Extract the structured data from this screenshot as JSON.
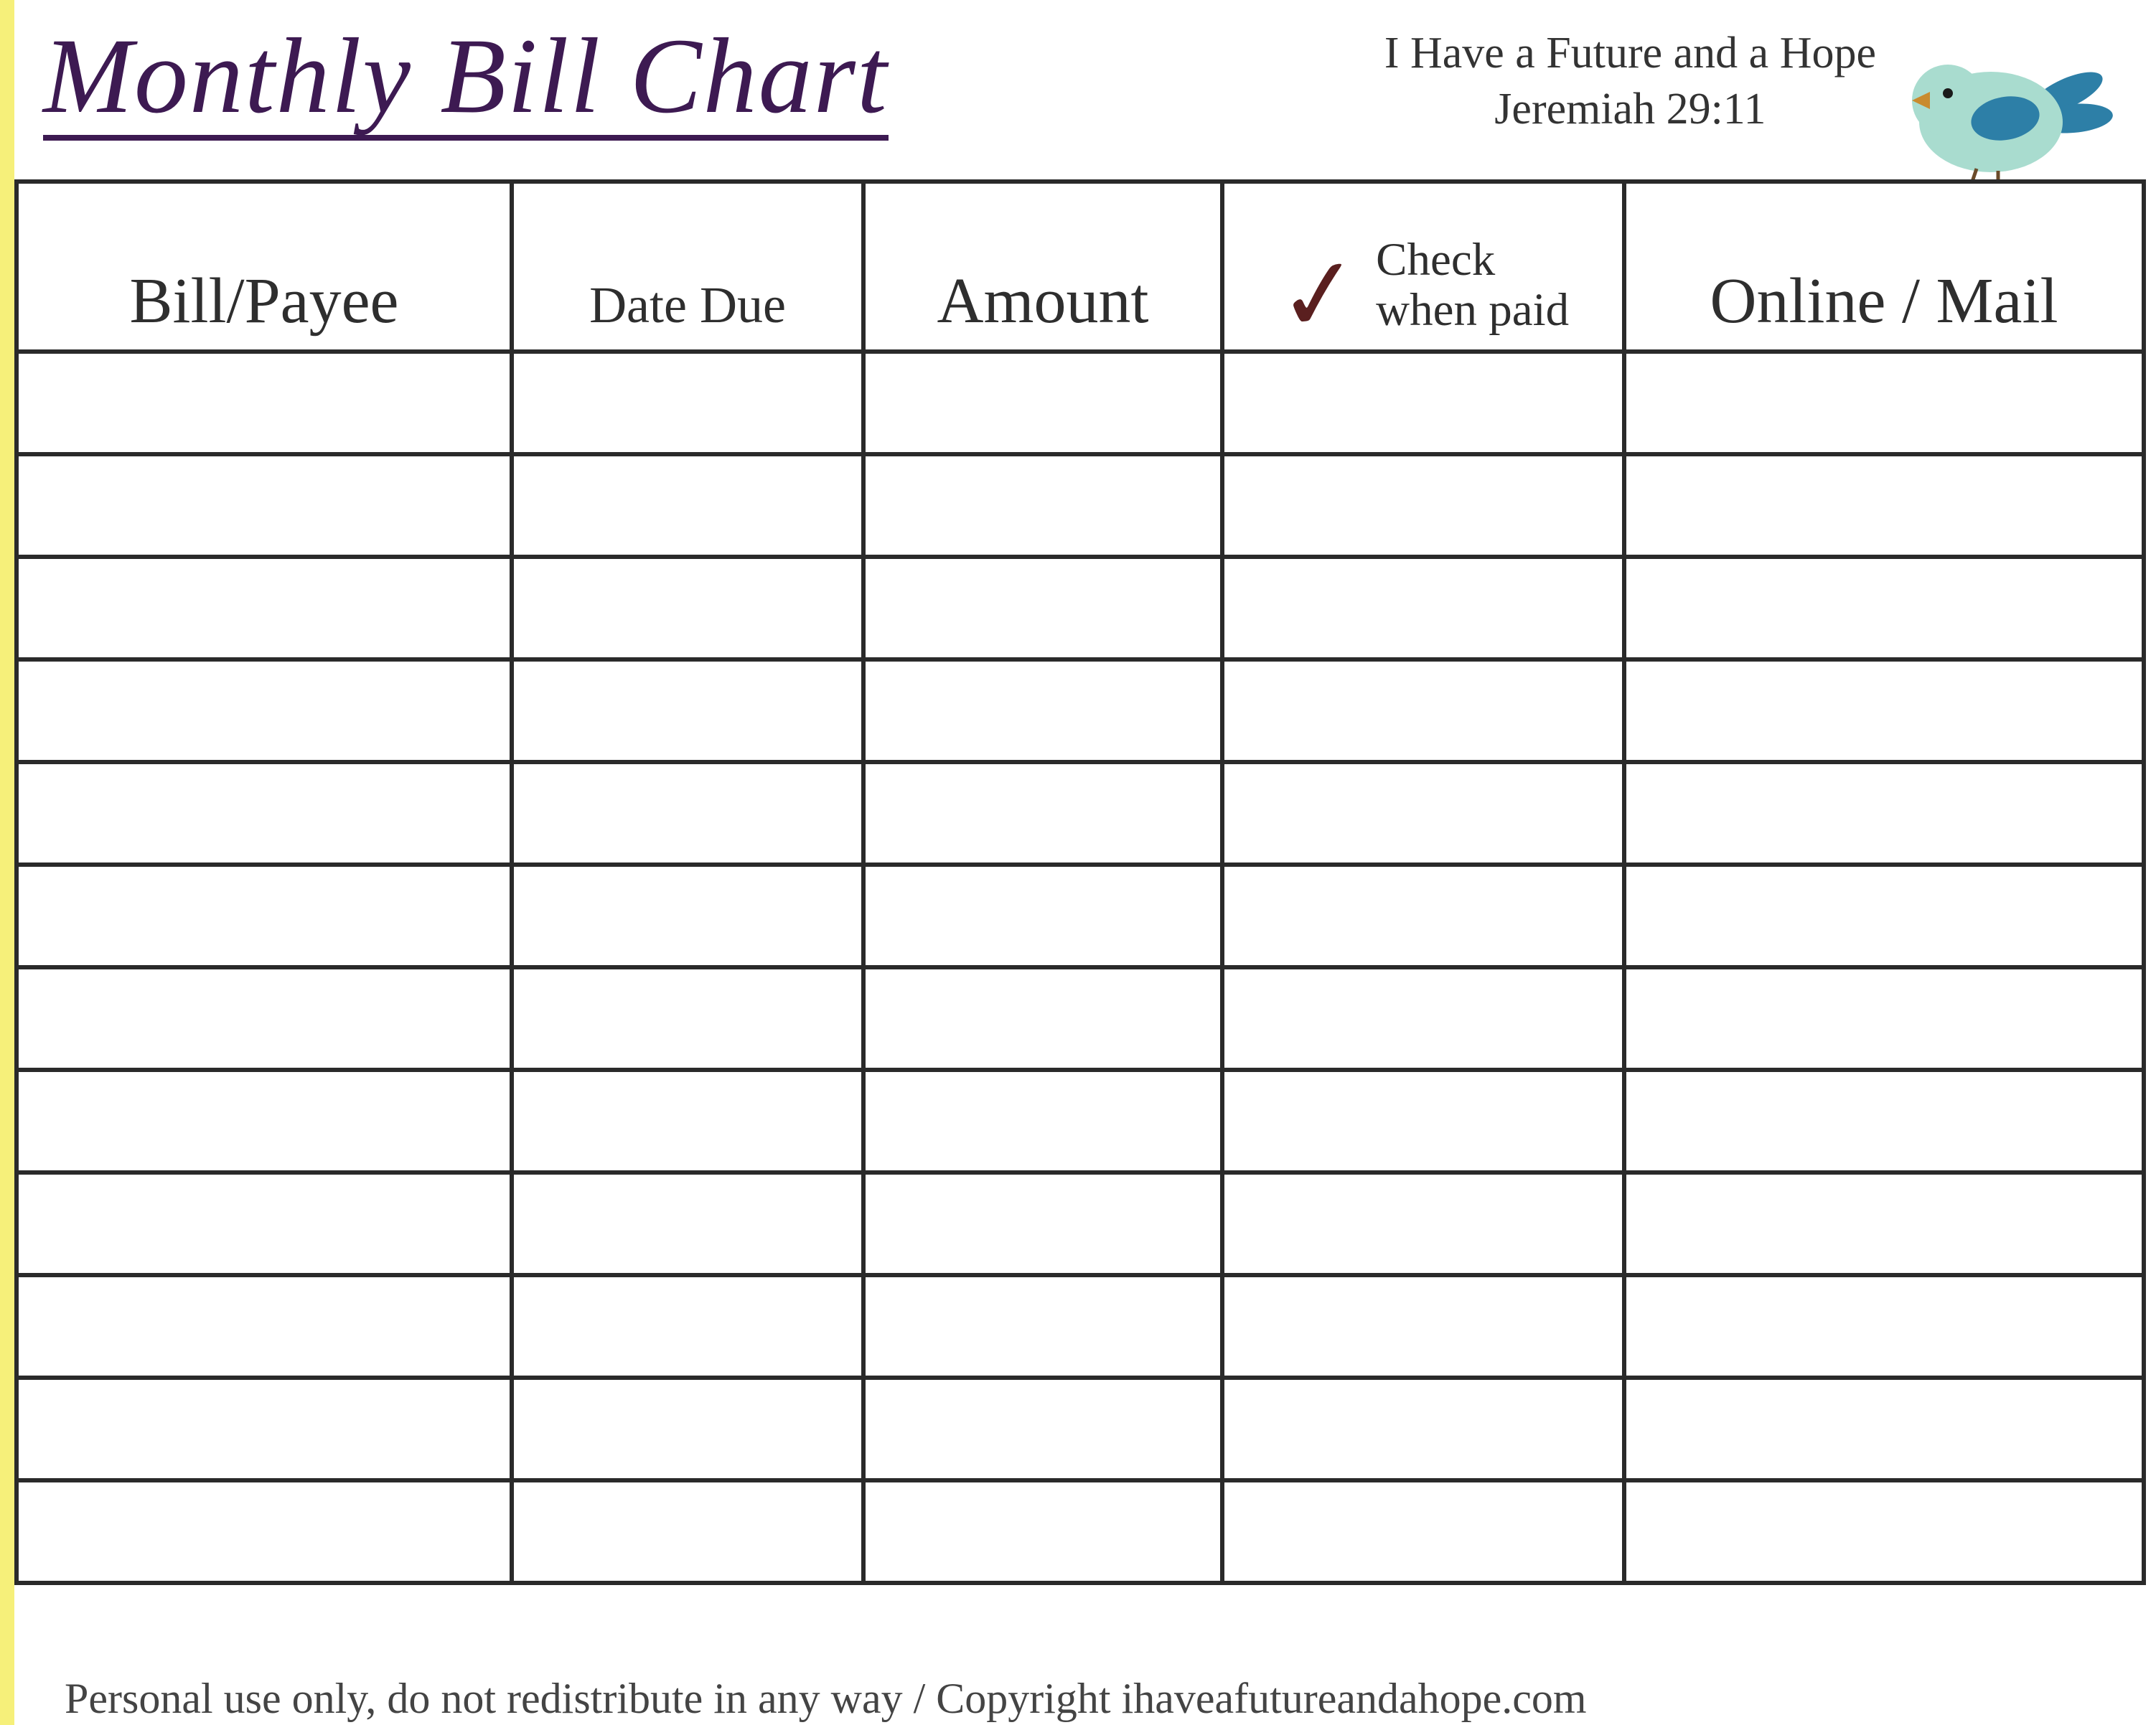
{
  "title": "Monthly Bill Chart",
  "quote_line1": "I Have a Future and a Hope",
  "quote_line2": "Jeremiah 29:11",
  "columns": {
    "c0": "Bill/Payee",
    "c1": "Date Due",
    "c2": "Amount",
    "c3_line1": "Check",
    "c3_line2": "when paid",
    "c4": "Online / Mail"
  },
  "checkmark_glyph": "✓",
  "row_count": 12,
  "footer": "Personal use only, do not redistribute in any way / Copyright ihaveafutureandahope.com",
  "bird_colors": {
    "body": "#a9dccf",
    "wing": "#2d7fa7",
    "tail": "#2d7fa7",
    "beak": "#c98b2e",
    "eye": "#1a1a1a",
    "legs": "#6b4b2a"
  },
  "chart_data": {
    "type": "table",
    "title": "Monthly Bill Chart",
    "columns": [
      "Bill/Payee",
      "Date Due",
      "Amount",
      "Check when paid",
      "Online / Mail"
    ],
    "rows": [
      [
        "",
        "",
        "",
        "",
        ""
      ],
      [
        "",
        "",
        "",
        "",
        ""
      ],
      [
        "",
        "",
        "",
        "",
        ""
      ],
      [
        "",
        "",
        "",
        "",
        ""
      ],
      [
        "",
        "",
        "",
        "",
        ""
      ],
      [
        "",
        "",
        "",
        "",
        ""
      ],
      [
        "",
        "",
        "",
        "",
        ""
      ],
      [
        "",
        "",
        "",
        "",
        ""
      ],
      [
        "",
        "",
        "",
        "",
        ""
      ],
      [
        "",
        "",
        "",
        "",
        ""
      ],
      [
        "",
        "",
        "",
        "",
        ""
      ],
      [
        "",
        "",
        "",
        "",
        ""
      ]
    ]
  }
}
